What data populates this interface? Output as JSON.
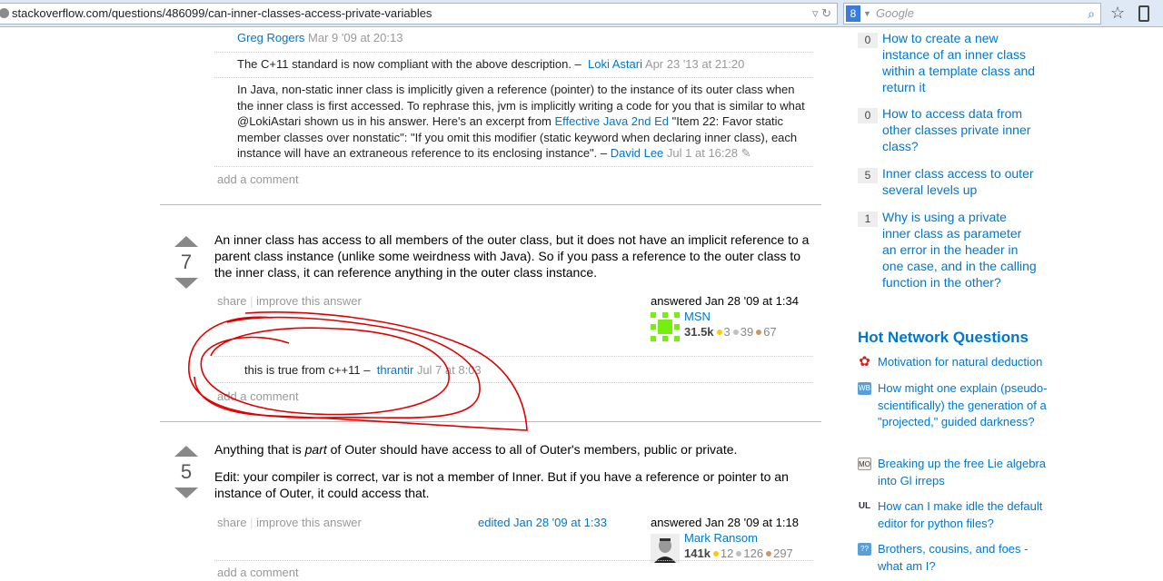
{
  "browser": {
    "url": "stackoverflow.com/questions/486099/can-inner-classes-access-private-variables",
    "search_placeholder": "Google",
    "search_engine_letter": "8"
  },
  "comments_top": [
    {
      "author": "Greg Rogers",
      "date": "Mar 9 '09 at 20:13"
    },
    {
      "text": "The C+11 standard is now compliant with the above description. –",
      "author": "Loki Astari",
      "date": "Apr 23 '13 at 21:20"
    },
    {
      "text_a": "In Java, non-static inner class is implicitly given a reference (pointer) to the instance of its outer class when the inner class is first accessed. To rephrase this, jvm is implicitly writing a code for you that is similar to what @LokiAstari shown us in his answer. Here's an excerpt from ",
      "link": "Effective Java 2nd Ed",
      "text_b": " \"Item 22: Favor static member classes over nonstatic\": \"If you omit this modifier (static keyword when declaring inner class), each instance will have an extraneous reference to its enclosing instance\". – ",
      "author": "David Lee",
      "date": "Jul 1 at 16:28"
    }
  ],
  "add_comment": "add a comment",
  "answers": [
    {
      "votes": "7",
      "body": "An inner class has access to all members of the outer class, but it does not have an implicit reference to a parent class instance (unlike some weirdness with Java). So if you pass a reference to the outer class to the inner class, it can reference anything in the outer class instance.",
      "share": "share",
      "improve": "improve this answer",
      "answered": "answered Jan 28 '09 at 1:34",
      "user": "MSN",
      "rep": "31.5k",
      "gold": "3",
      "silver": "39",
      "bronze": "67",
      "comment": {
        "text": "this is true from c++11 –",
        "author": "thrantir",
        "date": "Jul 7 at 8:03"
      }
    },
    {
      "votes": "5",
      "body_a": "Anything that is ",
      "body_em": "part",
      "body_b": " of Outer should have access to all of Outer's members, public or private.",
      "body2": "Edit: your compiler is correct, var is not a member of Inner. But if you have a reference or pointer to an instance of Outer, it could access that.",
      "share": "share",
      "improve": "improve this answer",
      "edited": "edited Jan 28 '09 at 1:33",
      "answered": "answered Jan 28 '09 at 1:18",
      "user": "Mark Ransom",
      "rep": "141k",
      "gold": "12",
      "silver": "126",
      "bronze": "297"
    }
  ],
  "related": [
    {
      "count": "0",
      "title": "How to create a new instance of an inner class within a template class and return it"
    },
    {
      "count": "0",
      "title": "How to access data from other classes private inner class?"
    },
    {
      "count": "5",
      "title": "Inner class access to outer several levels up"
    },
    {
      "count": "1",
      "title": "Why is using a private inner class as parameter an error in the header in one case, and in the calling function in the other?"
    }
  ],
  "hot_network": {
    "title": "Hot Network Questions",
    "items": [
      {
        "icon": "math-icon",
        "label": "Motivation for natural deduction",
        "color": "#cc2222",
        "glyph": "✿"
      },
      {
        "icon": "worldbuilding-icon",
        "label": "How might one explain (pseudo-scientifically) the generation of a \"projected,\" guided darkness?",
        "color": "#5a9fd6",
        "glyph": "WB"
      },
      {
        "icon": "mathoverflow-icon",
        "label": "Breaking up the free Lie algebra into Gl irreps",
        "color": "#999",
        "glyph": "MO"
      },
      {
        "icon": "unix-linux-icon",
        "label": "How can I make idle the default editor for python files?",
        "color": "#334",
        "glyph": "UL"
      },
      {
        "icon": "puzzling-icon",
        "label": "Brothers, cousins, and foes - what am I?",
        "color": "#5a9fd6",
        "glyph": "??"
      }
    ]
  },
  "colors": {
    "link": "#0077cc",
    "annotation": "#e00000",
    "gold": "#ffcc00",
    "silver": "#c0c0c0",
    "bronze": "#cc9966"
  }
}
